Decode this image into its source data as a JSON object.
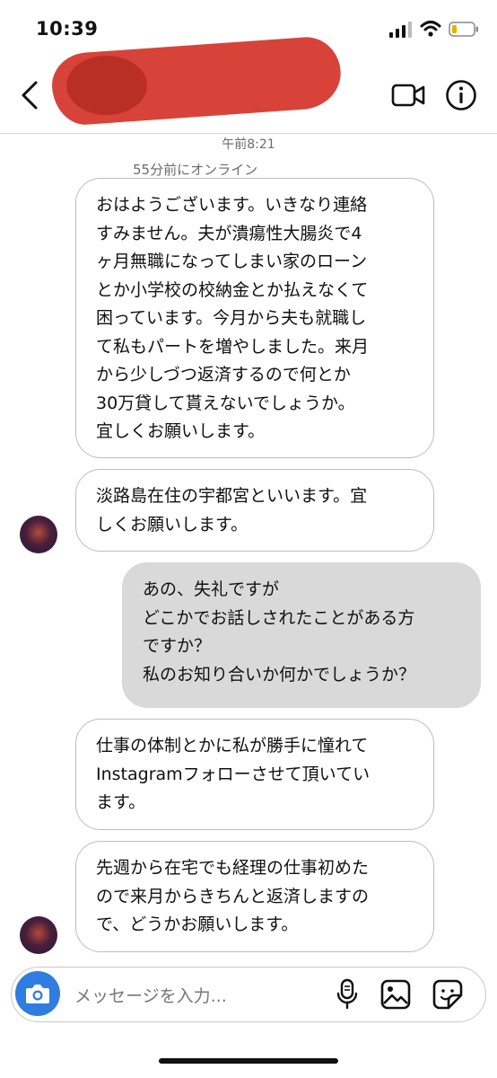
{
  "status": {
    "time": "10:39"
  },
  "header": {
    "online_status": "55分前にオンライン"
  },
  "thread": {
    "timestamp": "午前8:21",
    "messages": [
      {
        "from": "other",
        "text": "おはようございます。いきなり連絡\nすみません。夫が潰瘍性大腸炎で4\nヶ月無職になってしまい家のローン\nとか小学校の校納金とか払えなくて\n困っています。今月から夫も就職し\nて私もパートを増やしました。来月\nから少しづつ返済するので何とか\n30万貸して貰えないでしょうか。\n宜しくお願いします。"
      },
      {
        "from": "other",
        "text": "淡路島在住の宇都宮といいます。宜\nしくお願いします。"
      },
      {
        "from": "me",
        "text": "あの、失礼ですが\nどこかでお話しされたことがある方\nですか？\n私のお知り合いか何かでしょうか？"
      },
      {
        "from": "other",
        "text": "仕事の体制とかに私が勝手に憧れて\nInstagramフォローさせて頂いてい\nます。"
      },
      {
        "from": "other",
        "text": "先週から在宅でも経理の仕事初めた\nので来月からきちんと返済しますの\nで、どうかお願いします。"
      }
    ]
  },
  "composer": {
    "placeholder": "メッセージを入力..."
  },
  "colors": {
    "accent": "#2f7de0",
    "redaction": "#d6392e",
    "sent_bubble": "#d9d9d9"
  },
  "icons": [
    "back-icon",
    "video-call-icon",
    "info-icon",
    "camera-icon",
    "microphone-icon",
    "gallery-icon",
    "sticker-icon"
  ]
}
